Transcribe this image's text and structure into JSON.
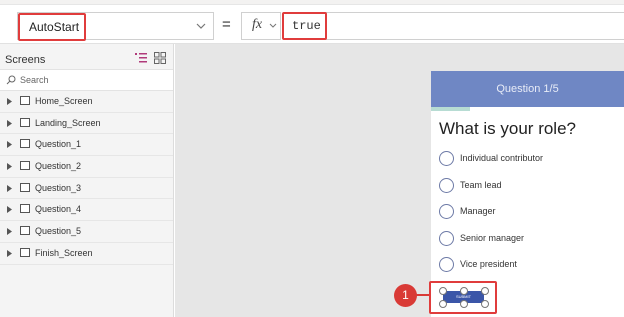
{
  "formula_bar": {
    "property": "AutoStart",
    "equals": "=",
    "fx_label": "fx",
    "formula": "true"
  },
  "screens_panel": {
    "title": "Screens",
    "search_placeholder": "Search",
    "items": [
      {
        "label": "Home_Screen"
      },
      {
        "label": "Landing_Screen"
      },
      {
        "label": "Question_1"
      },
      {
        "label": "Question_2"
      },
      {
        "label": "Question_3"
      },
      {
        "label": "Question_4"
      },
      {
        "label": "Question_5"
      },
      {
        "label": "Finish_Screen"
      }
    ]
  },
  "canvas": {
    "header_title": "Question 1/5",
    "progress_fraction": 0.2,
    "question": "What is your role?",
    "options": [
      {
        "label": "Individual contributor"
      },
      {
        "label": "Team lead"
      },
      {
        "label": "Manager"
      },
      {
        "label": "Senior manager"
      },
      {
        "label": "Vice president"
      }
    ],
    "submit_label": "SUBMIT",
    "callout_number": "1"
  },
  "colors": {
    "header": "#6f87c4",
    "accent_red": "#e03c3c",
    "submit": "#3b56a8",
    "progress": "#b7dcd3"
  },
  "icons": [
    "chevron-down-icon",
    "tree-view-icon",
    "grid-view-icon",
    "search-icon",
    "expand-icon",
    "screen-icon"
  ]
}
